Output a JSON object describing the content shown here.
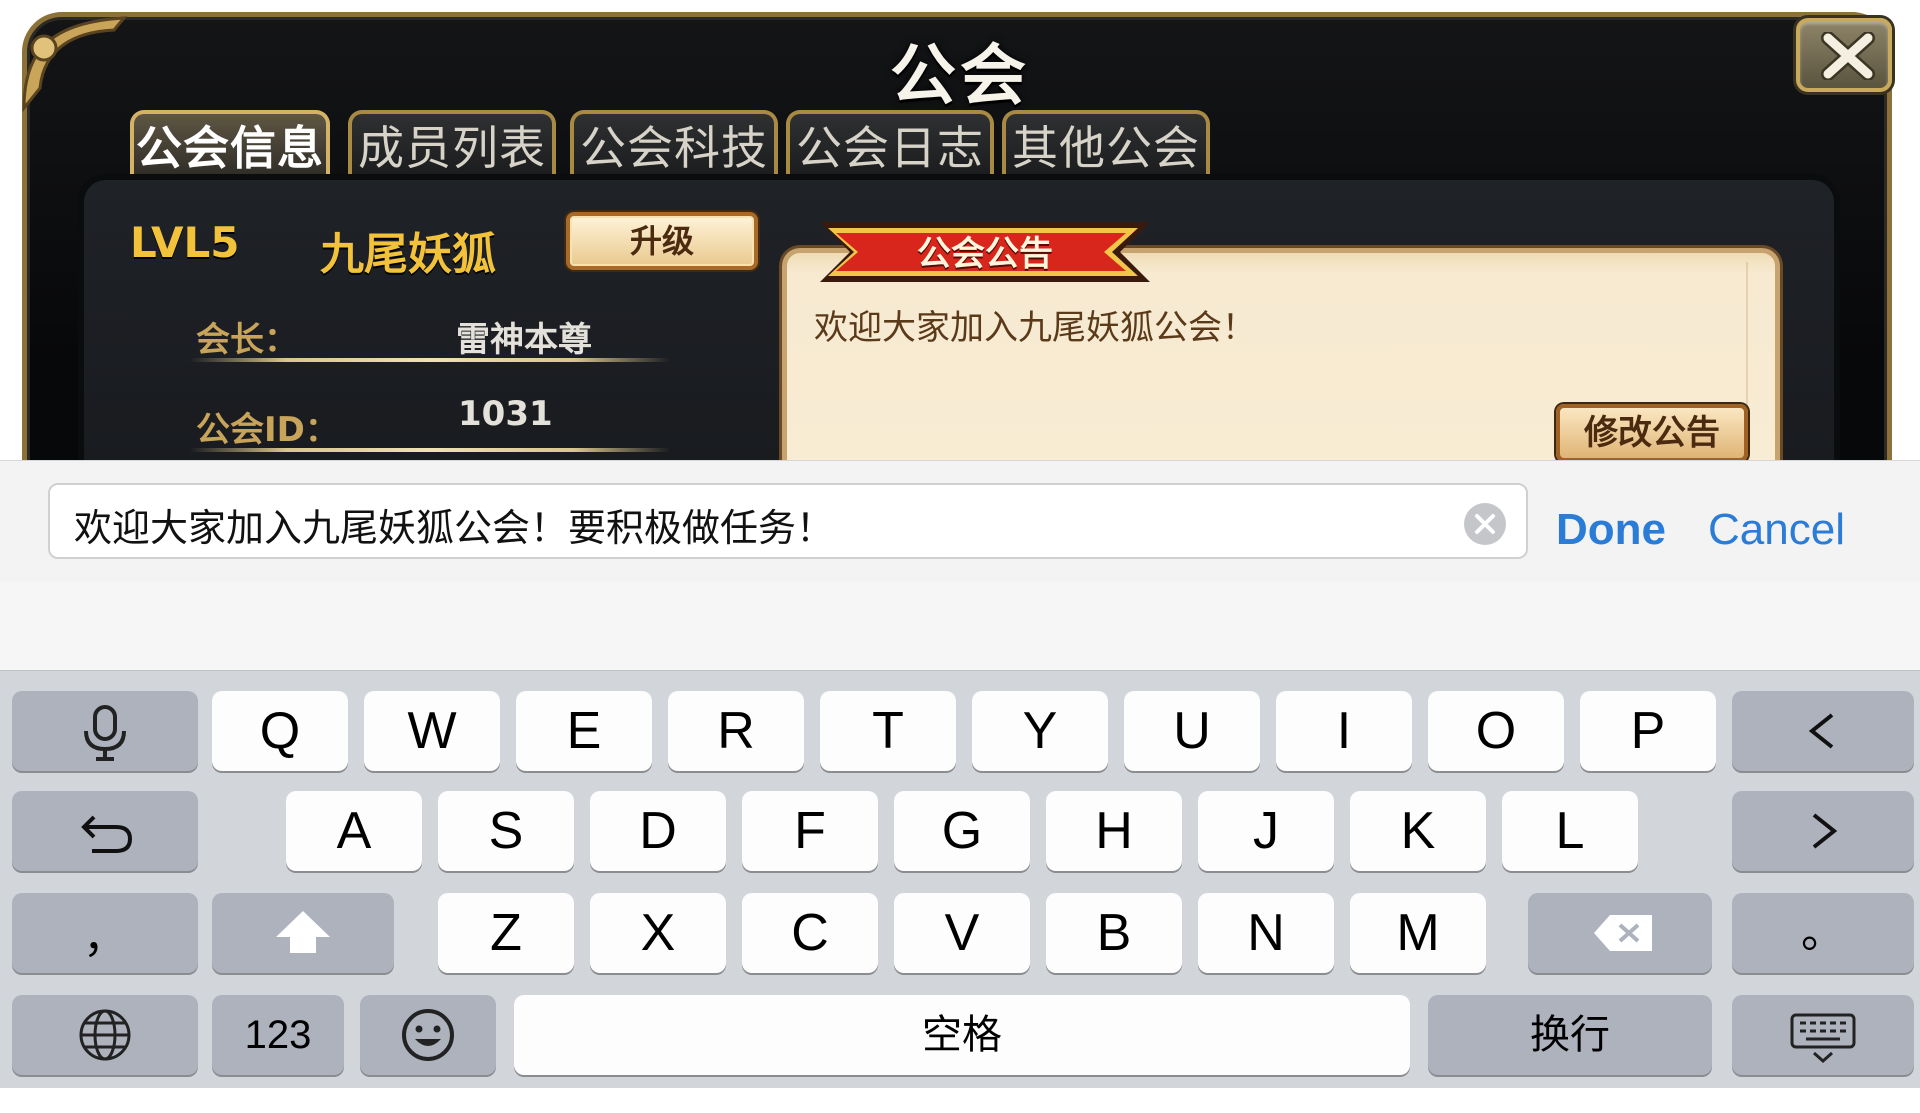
{
  "game": {
    "title": "公会",
    "tabs": [
      {
        "label": "公会信息",
        "active": true
      },
      {
        "label": "成员列表",
        "active": false
      },
      {
        "label": "公会科技",
        "active": false
      },
      {
        "label": "公会日志",
        "active": false
      },
      {
        "label": "其他公会",
        "active": false
      }
    ],
    "guild": {
      "level": "LVL5",
      "name": "九尾妖狐",
      "upgrade_label": "升级",
      "leader_label": "会长：",
      "leader_value": "雷神本尊",
      "id_label": "公会ID：",
      "id_value": "1031"
    },
    "notice": {
      "heading": "公会公告",
      "text": "欢迎大家加入九尾妖狐公会！",
      "edit_label": "修改公告"
    }
  },
  "input_bar": {
    "value": "欢迎大家加入九尾妖狐公会！要积极做任务！",
    "done_label": "Done",
    "cancel_label": "Cancel"
  },
  "keyboard": {
    "row1": [
      "Q",
      "W",
      "E",
      "R",
      "T",
      "Y",
      "U",
      "I",
      "O",
      "P"
    ],
    "row2": [
      "A",
      "S",
      "D",
      "F",
      "G",
      "H",
      "J",
      "K",
      "L"
    ],
    "row3": [
      "Z",
      "X",
      "C",
      "V",
      "B",
      "N",
      "M"
    ],
    "comma": "，",
    "period": "。",
    "numbers_label": "123",
    "space_label": "空格",
    "return_label": "换行",
    "icons": [
      "microphone-icon",
      "undo-icon",
      "shift-icon",
      "globe-icon",
      "emoji-icon",
      "backspace-icon",
      "keyboard-hide-icon",
      "arrow-left-icon",
      "arrow-right-icon"
    ]
  },
  "colors": {
    "gold": "#f2c23a",
    "ios_blue": "#2b7cd7",
    "keyboard_bg": "#d2d5da",
    "notice_bg": "#f8ecd4",
    "ribbon_red": "#d8261c"
  }
}
